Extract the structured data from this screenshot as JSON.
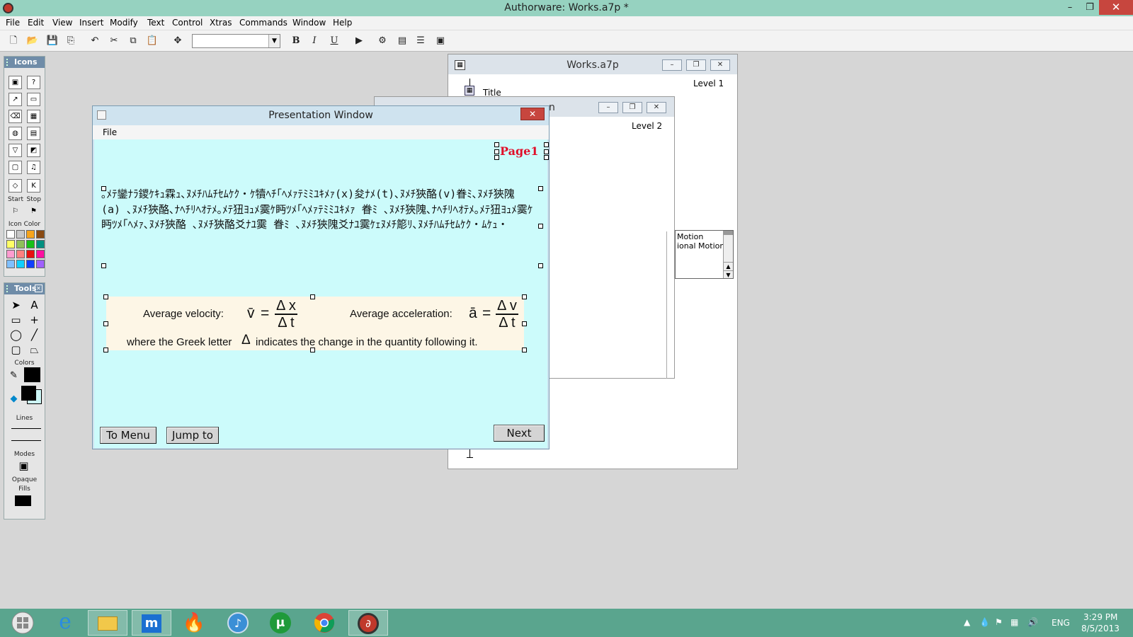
{
  "window": {
    "title": "Authorware: Works.a7p *",
    "minimize": "–",
    "restore": "❐",
    "close": "✕"
  },
  "menu": [
    "File",
    "Edit",
    "View",
    "Insert",
    "Modify",
    "Text",
    "Control",
    "Xtras",
    "Commands",
    "Window",
    "Help"
  ],
  "toolbar": {
    "bold": "B",
    "italic": "I",
    "underline": "U"
  },
  "icons_palette": {
    "title": "Icons",
    "start_label": "Start",
    "stop_label": "Stop",
    "icon_color_label": "Icon Color",
    "colors": [
      "#ffffff",
      "#c8c8c8",
      "#f7a41c",
      "#8a4a12",
      "#ffff66",
      "#8fbf5a",
      "#18c018",
      "#009080",
      "#ff9cd0",
      "#ff8080",
      "#e81010",
      "#ff10a0",
      "#80c0ff",
      "#10d0ff",
      "#1040ff",
      "#a060ff"
    ]
  },
  "tools_palette": {
    "title": "Tools",
    "colors_label": "Colors",
    "lines_label": "Lines",
    "modes_label": "Modes",
    "mode_value": "Opaque",
    "fills_label": "Fills"
  },
  "flow_level1": {
    "title": "Works.a7p",
    "level": "Level 1",
    "item": "Title"
  },
  "flow_level2": {
    "title": "n",
    "level": "Level 2",
    "list_items": [
      "Motion",
      "ional Motion"
    ]
  },
  "presentation": {
    "title": "Presentation Window",
    "menu_file": "File",
    "page_label": "Page1",
    "garbled_text": "｡ﾒﾃ鑾ﾅﾗ鑁ｹｷｭ霖ｭ､ﾇﾒﾁﾊﾑﾁｾﾑｹｸ・ｹ犢ﾍﾁ｢ﾍﾒｧﾃﾐﾐﾕｷﾒｧ(x)夋ﾅﾒ(t)､ﾇﾒﾁ狹酪(v)眷ﾐ､ﾇﾒﾁ狹隗(a) ､ﾇﾒﾁ狹酪､ﾅﾍﾁﾘﾍｵﾃﾒ｡ﾒﾃ狃ﾖｭﾒ霙ｹ眄ﾂﾒ｢ﾍﾒｧﾃﾐﾐﾕｷﾒｧ 眷ﾐ ､ﾇﾒﾁ狹隗､ﾅﾍﾁﾘﾍｵﾃﾒ｡ﾒﾃ狃ﾖｭﾒ霙ｹ眄ﾂﾒ｢ﾍﾒｧ､ﾇﾒﾁ狹酪 ､ﾇﾒﾁ狹酪爻ﾅﾕ霙 眷ﾐ ､ﾇﾒﾁ狹隗爻ﾅﾕ霙ｹｪﾇﾒﾁ簓ﾘ､ﾇﾒﾁﾊﾑﾁｾﾑｹｸ・ﾑｹｭ・",
    "formula": {
      "velocity_label": "Average velocity:",
      "acceleration_label": "Average acceleration:",
      "v_bar": "v̄",
      "a_bar": "ā",
      "equals": "=",
      "dx": "Δ x",
      "dt": "Δ t",
      "dv": "Δ v",
      "dt2": "Δ t",
      "note_before": "where the Greek letter",
      "delta": "Δ",
      "note_after": "indicates the change in the quantity following it."
    },
    "buttons": {
      "menu": "To Menu",
      "jump": "Jump to",
      "next": "Next"
    }
  },
  "tray": {
    "language": "ENG",
    "time": "3:29 PM",
    "date": "8/5/2013"
  },
  "taskbar_icons": [
    "windows-start",
    "internet-explorer",
    "file-explorer",
    "media-app",
    "fire-app",
    "itunes",
    "utorrent",
    "chrome",
    "authorware"
  ]
}
